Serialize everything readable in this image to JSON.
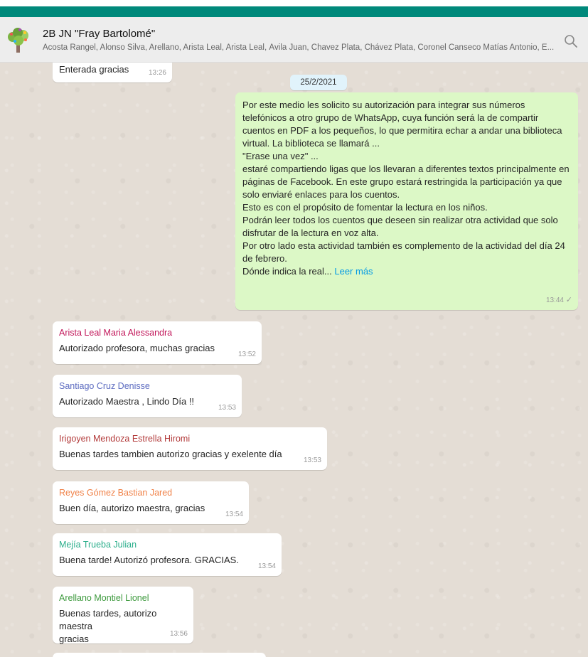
{
  "header": {
    "title": "2B JN \"Fray Bartolomé\"",
    "members": "Acosta Rangel, Alonso Silva, Arellano, Arista Leal, Arista Leal, Ávila Juan, Chavez Plata, Chávez Plata, Coronel Canseco Matías Antonio, E..."
  },
  "colors": {
    "header_bar": "#00897b",
    "outgoing_bubble": "#dcf8c6",
    "incoming_bubble": "#ffffff",
    "chat_background": "#e4ddd5",
    "link": "#039be5"
  },
  "icons": {
    "avatar": "tree-icon",
    "search": "search-icon",
    "read": "check-icon"
  },
  "top_message": {
    "text": "Enterada gracias",
    "time": "13:26"
  },
  "date_chip": "25/2/2021",
  "outgoing": {
    "text": "Por este medio les solicito su autorización para integrar sus números telefónicos a otro grupo de WhatsApp,  cuya función será la de compartir cuentos en PDF a los pequeños, lo que permitira echar a andar una biblioteca virtual. La biblioteca se llamará ...\n\"Erase una vez\" ...\nestaré compartiendo ligas que los llevaran a diferentes textos principalmente en páginas de Facebook. En este grupo estará restringida la participación ya que solo enviaré enlaces para los cuentos.\n Esto es con el propósito de fomentar la lectura  en los niños.\nPodrán leer todos los cuentos que deseen sin realizar otra actividad que solo disfrutar de la lectura en voz alta.\nPor otro lado esta actividad también es complemento de la actividad del día 24 de febrero.\nDónde indica la real... ",
    "read_more": "Leer más",
    "time": "13:44",
    "tick": "✓"
  },
  "messages": [
    {
      "sender": "Arista Leal Maria Alessandra",
      "color": "#c2185b",
      "text": "Autorizado profesora, muchas gracias",
      "time": "13:52"
    },
    {
      "sender": "Santiago Cruz Denisse",
      "color": "#5c6bc0",
      "text": "Autorizado Maestra , Lindo Día !!",
      "time": "13:53"
    },
    {
      "sender": "Irigoyen Mendoza Estrella Hiromi",
      "color": "#b23a3a",
      "text": "Buenas tardes tambien autorizo gracias y exelente día",
      "time": "13:53"
    },
    {
      "sender": "Reyes Gómez Bastian Jared",
      "color": "#f0834a",
      "text": "Buen día, autorizo maestra, gracias",
      "time": "13:54"
    },
    {
      "sender": "Mejía Trueba Julian",
      "color": "#2bae8b",
      "text": "Buena tarde! Autorizó profesora. GRACIAS.",
      "time": "13:54"
    },
    {
      "sender": "Arellano Montiel Lionel",
      "color": "#3e9a3e",
      "text": "Buenas tardes, autorizo maestra\ngracias",
      "time": "13:56"
    }
  ]
}
